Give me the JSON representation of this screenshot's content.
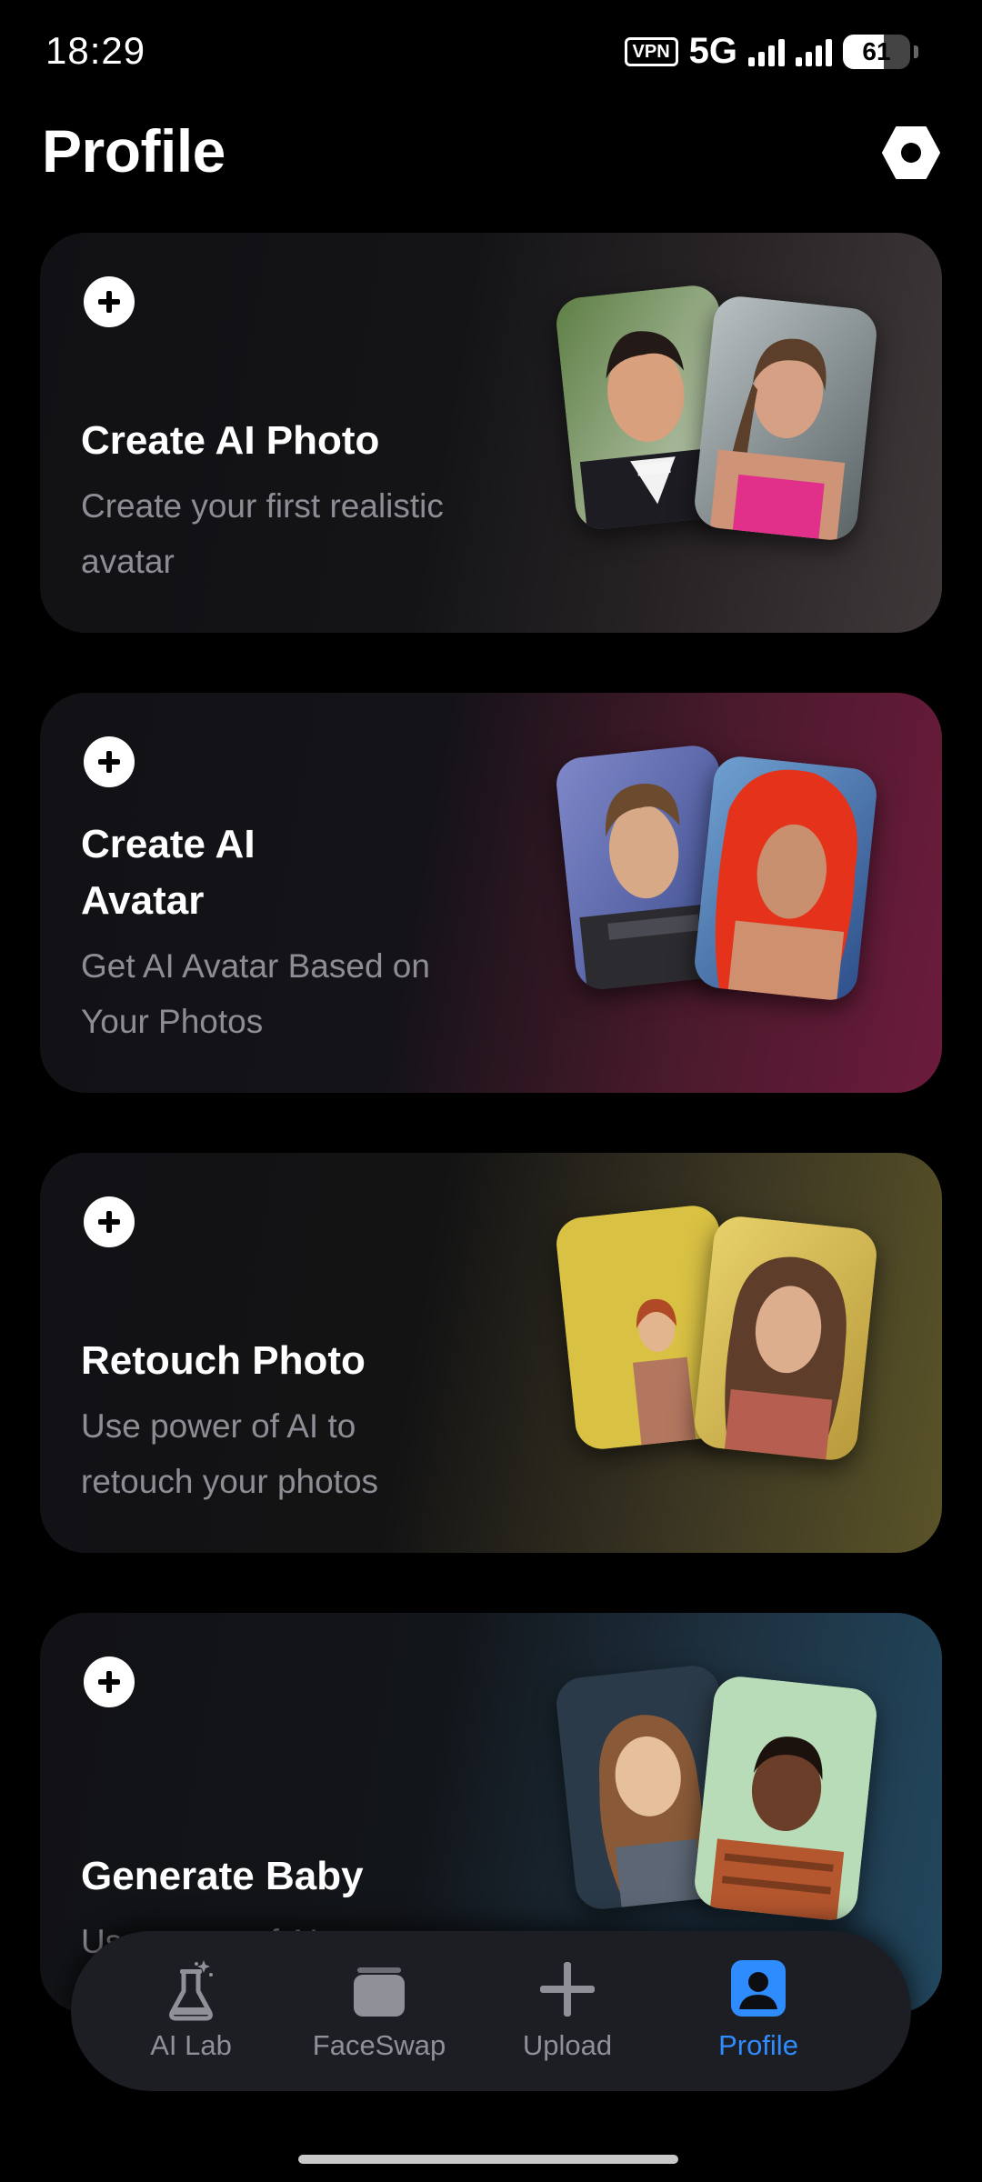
{
  "status_bar": {
    "time": "18:29",
    "vpn": "VPN",
    "network": "5G",
    "battery": "61"
  },
  "header": {
    "title": "Profile",
    "settings_icon": "hexagon-settings-icon"
  },
  "cards": [
    {
      "title": "Create AI Photo",
      "subtitle": "Create your first realistic avatar",
      "accent": "#3e3839"
    },
    {
      "title": "Create AI Avatar",
      "subtitle": "Get AI Avatar Based on Your Photos",
      "accent": "#6c1b3c"
    },
    {
      "title": "Retouch Photo",
      "subtitle": "Use power of AI to retouch your photos",
      "accent": "#5a5328"
    },
    {
      "title": "Generate Baby",
      "subtitle": "Use power of AI to se",
      "accent": "#22475e"
    }
  ],
  "bottom_nav": {
    "items": [
      {
        "label": "AI Lab",
        "icon": "flask-icon",
        "active": false
      },
      {
        "label": "FaceSwap",
        "icon": "cards-stack-icon",
        "active": false
      },
      {
        "label": "Upload",
        "icon": "plus-icon",
        "active": false
      },
      {
        "label": "Profile",
        "icon": "person-icon",
        "active": true
      }
    ],
    "active_color": "#2f8cff",
    "inactive_color": "#8f9098"
  }
}
